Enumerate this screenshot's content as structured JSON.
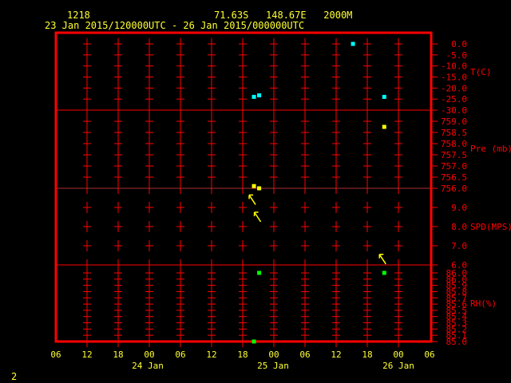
{
  "header": {
    "station_id": "1218",
    "location": "71.63S   148.67E   2000M",
    "time_range": "23 Jan 2015/120000UTC - 26 Jan 2015/000000UTC"
  },
  "footer": {
    "page_number": "2"
  },
  "colors": {
    "frame": "#ff0000",
    "text": "#ffff33",
    "temperature": "#00ffff",
    "pressure": "#ffff00",
    "wind": "#ffff00",
    "humidity": "#00ff00"
  },
  "chart_data": [
    {
      "type": "scatter",
      "ylabel": "T(C)",
      "ylim": [
        -30,
        0
      ],
      "yticks": [
        "0.0",
        "-5.0",
        "-10.0",
        "-15.0",
        "-20.0",
        "-25.0",
        "-30.0"
      ],
      "points": [
        {
          "x": "24 Jan 20:00",
          "y": -24.0
        },
        {
          "x": "24 Jan 21:00",
          "y": -23.3
        },
        {
          "x": "25 Jan 15:00",
          "y": 0.0
        },
        {
          "x": "25 Jan 21:00",
          "y": -24.0
        }
      ]
    },
    {
      "type": "scatter",
      "ylabel": "Pre (mb)",
      "ylim": [
        756.0,
        759.0
      ],
      "yticks": [
        "759.0",
        "758.5",
        "758.0",
        "757.5",
        "757.0",
        "756.5",
        "756.0"
      ],
      "points": [
        {
          "x": "24 Jan 20:00",
          "y": 756.1
        },
        {
          "x": "24 Jan 21:00",
          "y": 756.0
        },
        {
          "x": "25 Jan 21:00",
          "y": 758.75
        }
      ]
    },
    {
      "type": "scatter",
      "ylabel": "SPD(MPS)",
      "ylim": [
        6.0,
        10.0
      ],
      "yticks": [
        "9.0",
        "8.0",
        "7.0",
        "6.0"
      ],
      "marker": "wind-arrow",
      "points": [
        {
          "x": "24 Jan 20:00",
          "y": 9.4
        },
        {
          "x": "24 Jan 21:00",
          "y": 8.5
        },
        {
          "x": "25 Jan 21:00",
          "y": 6.3
        }
      ]
    },
    {
      "type": "scatter",
      "ylabel": "RH(%)",
      "ylim": [
        85.0,
        86.0
      ],
      "yticks": [
        "86.0",
        "86.0",
        "85.9",
        "85.8",
        "85.7",
        "85.6",
        "85.5",
        "85.4",
        "85.3",
        "85.2",
        "85.1",
        "85.0"
      ],
      "points": [
        {
          "x": "24 Jan 20:00",
          "y": 85.0
        },
        {
          "x": "24 Jan 21:00",
          "y": 86.0
        },
        {
          "x": "25 Jan 21:00",
          "y": 86.0
        }
      ]
    }
  ],
  "x_axis": {
    "range": [
      "23 Jan 06:00",
      "26 Jan 06:00"
    ],
    "tick_labels": [
      "06",
      "12",
      "18",
      "00",
      "06",
      "12",
      "18",
      "00",
      "06",
      "12",
      "18",
      "00",
      "06"
    ],
    "date_labels": [
      "24 Jan",
      "25 Jan",
      "26 Jan"
    ]
  }
}
